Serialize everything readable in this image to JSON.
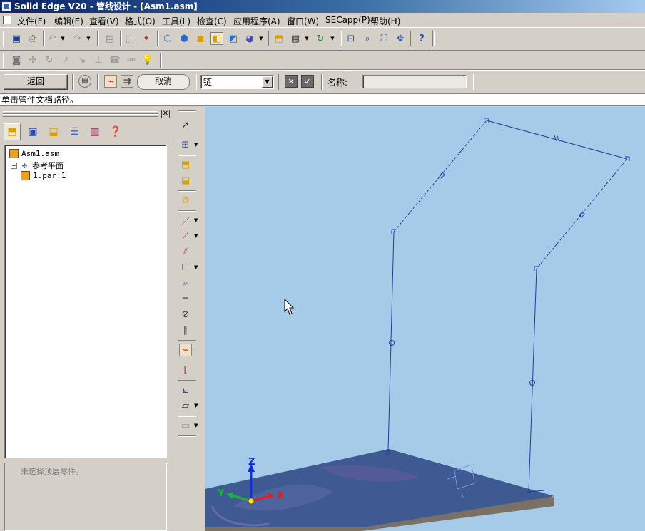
{
  "window": {
    "title": "Solid Edge V20 - 管线设计 - [Asm1.asm]"
  },
  "menu": [
    "文件(F)",
    "编辑(E)",
    "查看(V)",
    "格式(O)",
    "工具(L)",
    "检查(C)",
    "应用程序(A)",
    "窗口(W)",
    "SECapp(P)",
    "帮助(H)"
  ],
  "command_bar": {
    "back_label": "返回",
    "cancel_label": "取消",
    "select_value": "链",
    "name_label": "名称:",
    "name_value": ""
  },
  "prompt": "单击管件文档路径。",
  "tree": {
    "items": [
      {
        "label": "Asm1.asm"
      },
      {
        "label": "参考平面"
      },
      {
        "label": "1.par:1"
      }
    ]
  },
  "description": "未选择顶层零件。",
  "triad": {
    "x": "X",
    "y": "Y",
    "z": "Z"
  },
  "colors": {
    "title_start": "#0a246a",
    "viewport_bg": "#a6cbe9",
    "path_line": "#1f3f9a",
    "plate": "#3f5a92",
    "axis_x": "#e02020",
    "axis_y": "#20b040",
    "axis_z": "#1030e0"
  }
}
